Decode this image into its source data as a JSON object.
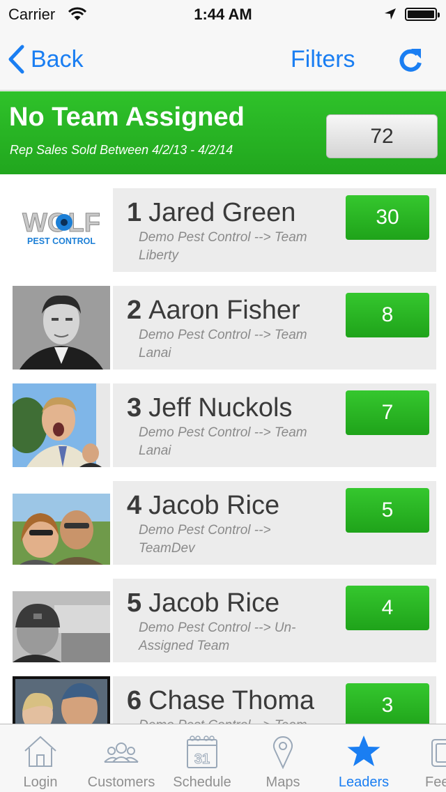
{
  "status_bar": {
    "carrier": "Carrier",
    "time": "1:44 AM"
  },
  "nav": {
    "back_label": "Back",
    "filters_label": "Filters",
    "refresh_icon": "refresh-icon"
  },
  "team": {
    "name": "No Team Assigned",
    "subtitle": "Rep Sales Sold Between 4/2/13 - 4/2/14",
    "total": "72"
  },
  "leaders": [
    {
      "rank": "1",
      "name": "Jared Green",
      "team": "Demo Pest Control --> Team Liberty",
      "score": "30",
      "avatar": "wolf-pest-control-logo"
    },
    {
      "rank": "2",
      "name": "Aaron Fisher",
      "team": "Demo Pest Control --> Team Lanai",
      "score": "8",
      "avatar": "photo"
    },
    {
      "rank": "3",
      "name": "Jeff Nuckols",
      "team": "Demo Pest Control --> Team Lanai",
      "score": "7",
      "avatar": "photo"
    },
    {
      "rank": "4",
      "name": "Jacob Rice",
      "team": "Demo Pest Control --> TeamDev",
      "score": "5",
      "avatar": "photo"
    },
    {
      "rank": "5",
      "name": "Jacob Rice",
      "team": "Demo Pest Control --> Un-Assigned Team",
      "score": "4",
      "avatar": "photo"
    },
    {
      "rank": "6",
      "name": "Chase Thoma",
      "team": "Demo Pest Control --> Team",
      "score": "3",
      "avatar": "photo"
    }
  ],
  "logo": {
    "line1": "WOLF",
    "line2": "PEST CONTROL"
  },
  "tabs": [
    {
      "label": "Login",
      "icon": "home-icon"
    },
    {
      "label": "Customers",
      "icon": "people-icon"
    },
    {
      "label": "Schedule",
      "icon": "calendar-icon",
      "icon_text": "31"
    },
    {
      "label": "Maps",
      "icon": "map-pin-icon"
    },
    {
      "label": "Leaders",
      "icon": "star-icon",
      "active": true
    },
    {
      "label": "Feed",
      "icon": "feed-icon"
    }
  ],
  "colors": {
    "accent_blue": "#1a7ef2",
    "green": "#2fc22a"
  }
}
